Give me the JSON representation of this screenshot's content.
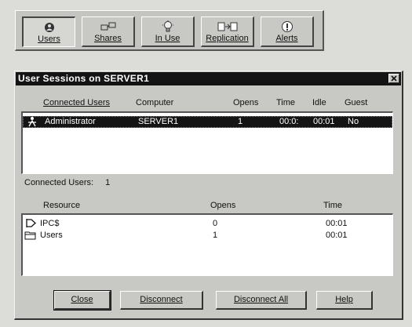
{
  "toolbar": {
    "buttons": [
      {
        "label": "Users",
        "icon": "users-icon"
      },
      {
        "label": "Shares",
        "icon": "shares-icon"
      },
      {
        "label": "In Use",
        "icon": "in-use-icon"
      },
      {
        "label": "Replication",
        "icon": "replication-icon"
      },
      {
        "label": "Alerts",
        "icon": "alerts-icon"
      }
    ]
  },
  "dialog": {
    "title": "User Sessions on SERVER1",
    "users_headers": {
      "connected_users": "Connected Users",
      "computer": "Computer",
      "opens": "Opens",
      "time": "Time",
      "idle": "Idle",
      "guest": "Guest"
    },
    "users": [
      {
        "name": "Administrator",
        "computer": "SERVER1",
        "opens": "1",
        "time": "00:0:",
        "idle": "00:01",
        "guest": "No"
      }
    ],
    "connected_count_label": "Connected Users:",
    "connected_count": "1",
    "resource_headers": {
      "resource": "Resource",
      "opens": "Opens",
      "time": "Time"
    },
    "resources": [
      {
        "name": "IPC$",
        "icon": "pipe-icon",
        "opens": "0",
        "time": "00:01"
      },
      {
        "name": "Users",
        "icon": "folder-icon",
        "opens": "1",
        "time": "00:01"
      }
    ],
    "buttons": {
      "close": "Close",
      "disconnect": "Disconnect",
      "disconnect_all": "Disconnect All",
      "help": "Help"
    }
  }
}
